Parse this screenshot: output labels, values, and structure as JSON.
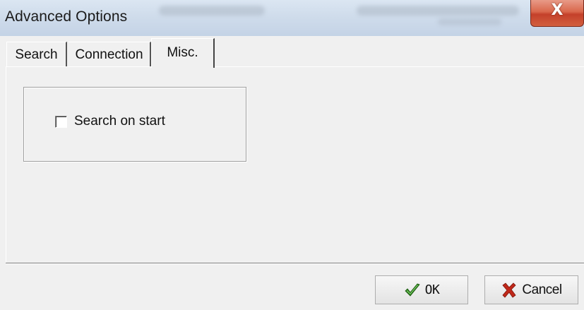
{
  "window": {
    "title": "Advanced Options",
    "close_glyph": "X",
    "icons": {
      "close": "close-icon"
    }
  },
  "tabs": [
    {
      "label": "Search",
      "selected": false
    },
    {
      "label": "Connection",
      "selected": false
    },
    {
      "label": "Misc.",
      "selected": true
    }
  ],
  "misc": {
    "search_on_start": {
      "label": "Search on start",
      "checked": false
    }
  },
  "buttons": {
    "ok": {
      "label": "OK",
      "icon": "checkmark-icon",
      "icon_color": "#2a7a1a"
    },
    "cancel": {
      "label": "Cancel",
      "icon": "x-mark-icon",
      "icon_color": "#c0281a"
    }
  },
  "colors": {
    "dialog_bg": "#f0f0f0",
    "close_button": "#d0503a"
  }
}
